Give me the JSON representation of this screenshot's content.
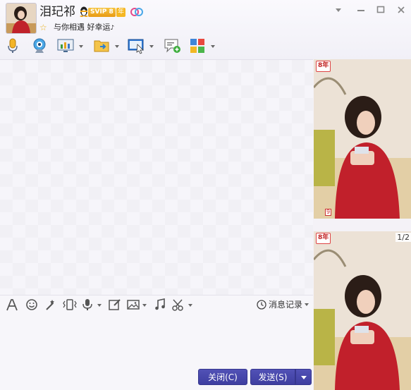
{
  "contact": {
    "name": "泪玘祁",
    "vip_badge": "SVIP 8",
    "year_badge": "年",
    "signature": "与你相遇 好幸运",
    "signature_icon": "♪"
  },
  "icons": {
    "star": "☆",
    "history": "clock-icon"
  },
  "input_toolbar": {
    "history_label": "消息记录"
  },
  "buttons": {
    "close_label": "关闭(C)",
    "send_label": "发送(S)"
  },
  "photos": {
    "top_badge": "8年",
    "bottom_badge": "8年",
    "counter": "1/2",
    "like_count": "9"
  },
  "colors": {
    "accent": "#4646a8",
    "vip_gold": "#f0b023",
    "header_bg": "#f4f3f9"
  }
}
